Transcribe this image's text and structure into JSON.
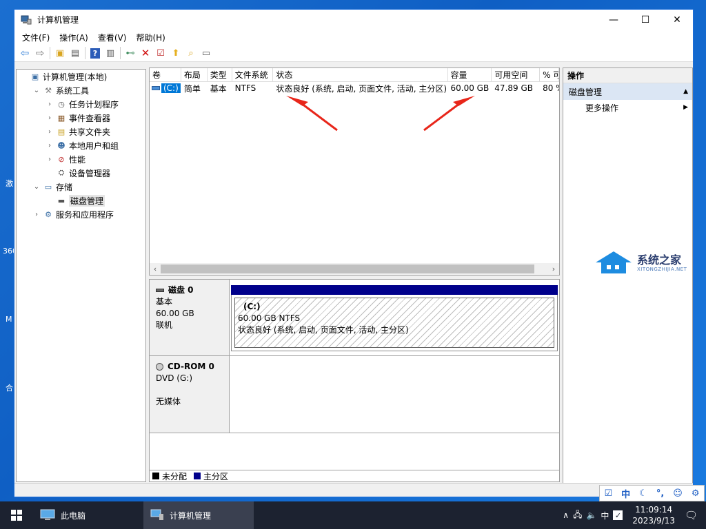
{
  "window": {
    "title": "计算机管理",
    "controls": [
      "—",
      "☐",
      "✕"
    ]
  },
  "menubar": [
    "文件(F)",
    "操作(A)",
    "查看(V)",
    "帮助(H)"
  ],
  "tree": [
    {
      "label": "计算机管理(本地)",
      "icon": "computer-mgmt-icon",
      "level": 0,
      "expander": ""
    },
    {
      "label": "系统工具",
      "icon": "system-tools-icon",
      "level": 1,
      "expander": "v"
    },
    {
      "label": "任务计划程序",
      "icon": "task-scheduler-icon",
      "level": 2,
      "expander": ">"
    },
    {
      "label": "事件查看器",
      "icon": "event-viewer-icon",
      "level": 2,
      "expander": ">"
    },
    {
      "label": "共享文件夹",
      "icon": "shared-folders-icon",
      "level": 2,
      "expander": ">"
    },
    {
      "label": "本地用户和组",
      "icon": "local-users-icon",
      "level": 2,
      "expander": ">"
    },
    {
      "label": "性能",
      "icon": "performance-icon",
      "level": 2,
      "expander": ">"
    },
    {
      "label": "设备管理器",
      "icon": "device-manager-icon",
      "level": 2,
      "expander": ""
    },
    {
      "label": "存储",
      "icon": "storage-icon",
      "level": 1,
      "expander": "v"
    },
    {
      "label": "磁盘管理",
      "icon": "disk-management-icon",
      "level": 2,
      "expander": "",
      "selected": true
    },
    {
      "label": "服务和应用程序",
      "icon": "services-icon",
      "level": 1,
      "expander": ">"
    }
  ],
  "volume_table": {
    "headers": [
      "卷",
      "布局",
      "类型",
      "文件系统",
      "状态",
      "容量",
      "可用空间",
      "% 可"
    ],
    "rows": [
      [
        "(C:)",
        "简单",
        "基本",
        "NTFS",
        "状态良好 (系统, 启动, 页面文件, 活动, 主分区)",
        "60.00 GB",
        "47.89 GB",
        "80 %"
      ]
    ]
  },
  "disks": [
    {
      "name": "磁盘 0",
      "type": "基本",
      "size": "60.00 GB",
      "state": "联机",
      "partition": {
        "name": "(C:)",
        "size_fs": "60.00 GB NTFS",
        "status": "状态良好 (系统, 启动, 页面文件, 活动, 主分区)"
      }
    },
    {
      "name": "CD-ROM 0",
      "type": "DVD (G:)",
      "size": "",
      "state": "无媒体"
    }
  ],
  "legend": [
    {
      "label": "未分配",
      "color": "#000000"
    },
    {
      "label": "主分区",
      "color": "#00008b"
    }
  ],
  "actions": {
    "header": "操作",
    "section": "磁盘管理",
    "items": [
      "更多操作"
    ]
  },
  "watermark": {
    "title": "系统之家",
    "sub": "XITONGZHIJIA.NET"
  },
  "ime_bar": [
    "中"
  ],
  "taskbar": {
    "items": [
      "此电脑",
      "计算机管理"
    ],
    "tray_ime": "中",
    "time": "11:09:14",
    "date": "2023/9/13"
  }
}
